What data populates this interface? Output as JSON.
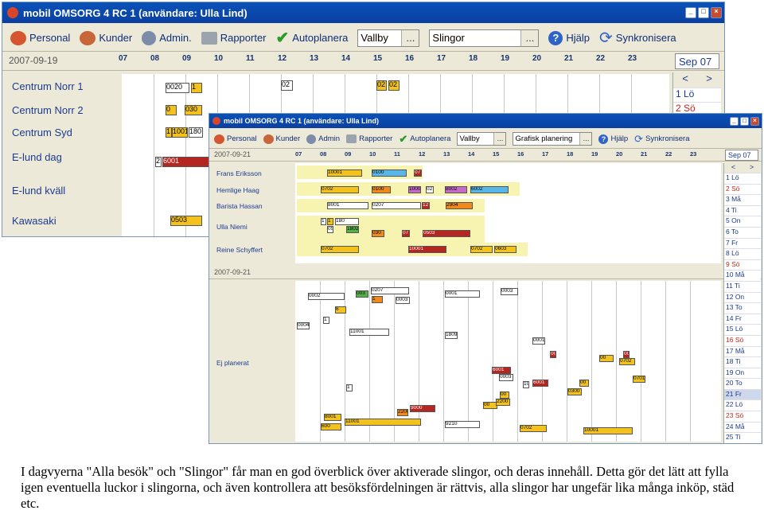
{
  "back_window": {
    "title": "mobil OMSORG 4 RC 1 (användare: Ulla Lind)",
    "toolbar": [
      "Personal",
      "Kunder",
      "Admin.",
      "Rapporter",
      "Autoplanera"
    ],
    "combo1": "Vallby",
    "combo2": "Slingor",
    "combo_dots": "...",
    "help": "Hjälp",
    "sync": "Synkronisera",
    "date": "2007-09-19",
    "hours": [
      "07",
      "08",
      "09",
      "10",
      "11",
      "12",
      "13",
      "14",
      "15",
      "16",
      "17",
      "18",
      "19",
      "20",
      "21",
      "22",
      "23"
    ],
    "month": "Sep 07",
    "nav_prev": "<",
    "nav_next": ">",
    "cal_days": [
      "1 Lö",
      "2 Sö"
    ],
    "rows": [
      "Centrum Norr 1",
      "Centrum Norr 2",
      "Centrum Syd",
      "E-lund dag",
      "E-lund kväll",
      "Kawasaki"
    ],
    "bars": [
      "0020",
      "1",
      "0",
      "030",
      "1",
      "1001",
      "180",
      "2",
      "6001",
      "02",
      "02",
      "02",
      "0503"
    ]
  },
  "front_window": {
    "title": "mobil OMSORG 4 RC 1 (användare: Ulla Lind)",
    "toolbar": [
      "Personal",
      "Kunder",
      "Admin",
      "Rapporter",
      "Autoplanera"
    ],
    "combo1": "Vallby",
    "combo2": "Grafisk planering",
    "combo_dots": "...",
    "help": "Hjälp",
    "sync": "Synkronisera",
    "date": "2007-09-21",
    "date2": "2007-09-21",
    "hours": [
      "07",
      "08",
      "09",
      "10",
      "11",
      "12",
      "13",
      "14",
      "15",
      "16",
      "17",
      "18",
      "19",
      "20",
      "21",
      "22",
      "23"
    ],
    "month": "Sep 07",
    "nav_prev": "<",
    "nav_next": ">",
    "cal_days": [
      "1 Lö",
      "2 Sö",
      "3 Må",
      "4 Ti",
      "5 On",
      "6 To",
      "7 Fr",
      "8 Lö",
      "9 Sö",
      "10 Må",
      "11 Ti",
      "12 On",
      "13 To",
      "14 Fr",
      "15 Lö",
      "16 Sö",
      "17 Må",
      "18 Ti",
      "19 On",
      "20 To",
      "21 Fr",
      "22 Lö",
      "23 Sö",
      "24 Må",
      "25 Ti"
    ],
    "rows": [
      "Frans Eriksson",
      "Hemlige Haag",
      "Barista Hassan",
      "Ulla Niemi",
      "Reine Schyffert",
      "Ej planerat"
    ],
    "bars": [
      "10001",
      "0100",
      "07",
      "0702",
      "0100",
      "1000",
      "02",
      "8002",
      "6002",
      "8001",
      "0207",
      "12",
      "2904",
      "1",
      "0503",
      "1",
      "180",
      "1802",
      "030",
      "07",
      "0503",
      "0702",
      "10001",
      "0702",
      "0603",
      "0002",
      "0207",
      "003",
      "1",
      "0003",
      "6",
      "0004",
      "1",
      "0001",
      "0003",
      "1809",
      "11001",
      "0001",
      "00",
      "6001",
      "00",
      "0702",
      "00",
      "00",
      "0701",
      "0300",
      "10",
      "6001",
      "0003",
      "1",
      "00",
      "2200",
      "9000",
      "00",
      "2200",
      "8001",
      "11001",
      "9210",
      "0702",
      "10001",
      "600"
    ]
  },
  "caption": "I dagvyerna \"Alla besök\" och \"Slingor\" får man en god överblick över aktiverade slingor, och deras innehåll. Detta gör det lätt att fylla igen eventuella luckor i slingorna, och även kontrollera att besöksfördelningen är rättvis, alla slingor har ungefär lika många inköp, städ etc."
}
